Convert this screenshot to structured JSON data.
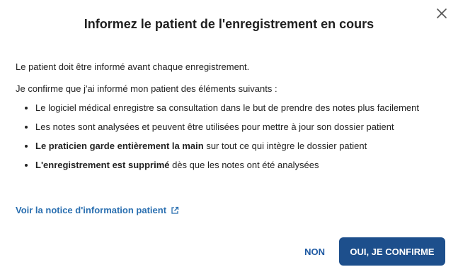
{
  "dialog": {
    "title": "Informez le patient de l'enregistrement en cours",
    "close_icon": "close-icon"
  },
  "body": {
    "intro": "Le patient doit être informé avant chaque enregistrement.",
    "confirm_text": "Je confirme que j'ai informé mon patient des éléments suivants :",
    "bullets": [
      {
        "bold": "",
        "text": "Le logiciel médical enregistre sa consultation dans le but de prendre des notes plus facilement"
      },
      {
        "bold": "",
        "text": "Les notes sont analysées et peuvent être utilisées pour mettre à jour son dossier patient"
      },
      {
        "bold": "Le praticien garde entièrement la main",
        "text": " sur tout ce qui intègre le dossier patient"
      },
      {
        "bold": "L'enregistrement est supprimé",
        "text": " dès que les notes ont été analysées"
      }
    ]
  },
  "link": {
    "label": "Voir la notice d'information patient",
    "icon": "external-link-icon"
  },
  "actions": {
    "non_label": "NON",
    "confirm_label": "OUI, JE CONFIRME"
  },
  "colors": {
    "accent": "#1d4f8c",
    "link": "#2a6fb0"
  }
}
